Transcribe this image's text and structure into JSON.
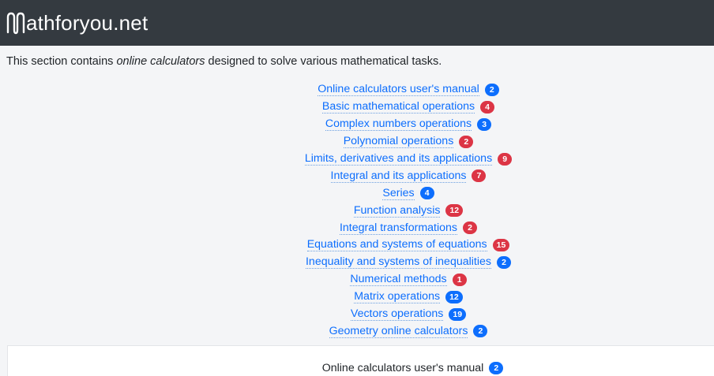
{
  "header": {
    "logo_text": "athforyou.net",
    "background": "#343a40"
  },
  "intro": {
    "before": "This section contains ",
    "emphasis": "online calculators",
    "after": " designed to solve various mathematical tasks."
  },
  "categories": [
    {
      "label": "Online calculators user's manual",
      "count": "2",
      "color": "blue"
    },
    {
      "label": "Basic mathematical operations",
      "count": "4",
      "color": "red"
    },
    {
      "label": "Complex numbers operations",
      "count": "3",
      "color": "blue"
    },
    {
      "label": "Polynomial operations",
      "count": "2",
      "color": "red"
    },
    {
      "label": "Limits, derivatives and its applications",
      "count": "9",
      "color": "red"
    },
    {
      "label": "Integral and its applications",
      "count": "7",
      "color": "red"
    },
    {
      "label": "Series",
      "count": "4",
      "color": "blue"
    },
    {
      "label": "Function analysis",
      "count": "12",
      "color": "red"
    },
    {
      "label": "Integral transformations",
      "count": "2",
      "color": "red"
    },
    {
      "label": "Equations and systems of equations",
      "count": "15",
      "color": "red"
    },
    {
      "label": "Inequality and systems of inequalities",
      "count": "2",
      "color": "blue"
    },
    {
      "label": "Numerical methods",
      "count": "1",
      "color": "red"
    },
    {
      "label": "Matrix operations",
      "count": "12",
      "color": "blue"
    },
    {
      "label": "Vectors operations",
      "count": "19",
      "color": "blue"
    },
    {
      "label": "Geometry online calculators",
      "count": "2",
      "color": "blue"
    }
  ],
  "section": {
    "title": "Online calculators user's manual",
    "count": "2"
  },
  "colors": {
    "link": "#0d6efd",
    "badge_blue": "#0d6efd",
    "badge_red": "#dc3545"
  }
}
